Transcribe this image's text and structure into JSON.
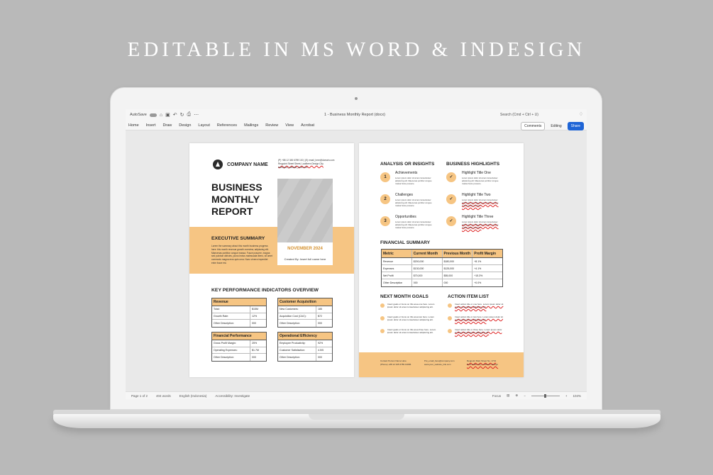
{
  "headline": "EDITABLE IN MS WORD & INDESIGN",
  "app": {
    "autosave_label": "AutoSave",
    "doc_title": "1 - Business Monthly Report (docx)",
    "search_placeholder": "Search (Cmd + Ctrl + U)",
    "tabs": [
      "Home",
      "Insert",
      "Draw",
      "Design",
      "Layout",
      "References",
      "Mailings",
      "Review",
      "View",
      "Acrobat"
    ],
    "comments_label": "Comments",
    "editing_label": "Editing",
    "share_label": "Share",
    "status": {
      "page": "Page 1 of 2",
      "words": "404 words",
      "language": "English (Indonesia)",
      "accessibility": "Accessibility: Investigate",
      "focus": "Focus",
      "zoom": "104%"
    }
  },
  "page1": {
    "company": "COMPANY NAME",
    "contact": [
      "(P) +88 12 345 6789 100  |  (E) email_here@domain.com",
      "Reqpoint Street Street, Laufbeen Design City",
      "www.your_website_here.com"
    ],
    "title_lines": [
      "BUSINESS",
      "MONTHLY",
      "REPORT"
    ],
    "exec_title": "EXECUTIVE SUMMARY",
    "exec_text": "Lorem the summary about this month business progress here: this month revenue growth overview, adipiscing elit. Maecenas porttitor congue massa. Fusce posuere, magna sed pulvinar ultricies, purus lectus malesuada libero, sit amet commodo magna eros quis urna. Nunc viverra imperdiet enim fusce est.",
    "month": "NOVEMBER 2024",
    "created": "Created By:  Insert full name here",
    "kpi_title": "KEY PERFORMANCE INDICATORS OVERVIEW",
    "kpi": [
      {
        "title": "Revenue",
        "rows": [
          [
            "Total:",
            "$15M"
          ],
          [
            "Growth Rate:",
            "12%"
          ],
          [
            "Other Description:",
            "000"
          ]
        ]
      },
      {
        "title": "Customer Acquisition",
        "rows": [
          [
            "New Customers:",
            "185"
          ],
          [
            "Acquisition Cost (CAC):",
            "$72"
          ],
          [
            "Other Description:",
            "000"
          ]
        ]
      },
      {
        "title": "Financial Performance",
        "rows": [
          [
            "Gross Profit Margin:",
            "25%"
          ],
          [
            "Operating Expenses:",
            "$1.7M"
          ],
          [
            "Other Description:",
            "000"
          ]
        ]
      },
      {
        "title": "Operational Efficiency",
        "rows": [
          [
            "Employee Productivity:",
            "92%"
          ],
          [
            "Customer Satisfaction:",
            "4.5/5"
          ],
          [
            "Other Description:",
            "000"
          ]
        ]
      }
    ]
  },
  "page2": {
    "analysis_title": "ANALYSIS OR INSIGHTS",
    "analysis": [
      {
        "num": "1",
        "title": "Achievements",
        "text": "Lorem ipsum dolor sit amet consectetuer adipiscing elit. Maecenas porttitor congue massa fusce posuere."
      },
      {
        "num": "2",
        "title": "Challenges",
        "text": "Lorem ipsum dolor sit amet consectetuer adipiscing elit. Maecenas porttitor congue massa fusce posuere."
      },
      {
        "num": "3",
        "title": "Opportunities",
        "text": "Lorem ipsum dolor sit amet consectetuer adipiscing elit. Maecenas porttitor congue massa fusce posuere."
      }
    ],
    "highlights_title": "BUSINESS HIGHLIGHTS",
    "highlights": [
      {
        "title": "Highlight Title One",
        "text": "Lorem ipsum dolor sit amet consectetuer adipiscing elit. Maecenas porttitor congue massa fusce posuere."
      },
      {
        "title": "Highlight Title Two",
        "text": "Lorem ipsum dolor sit amet consectetuer adipiscing elit. Maecenas porttitor congue massa fusce posuere."
      },
      {
        "title": "Highlight Title Three",
        "text": "Lorem ipsum dolor sit amet consectetuer adipiscing elit. Maecenas porttitor congue massa fusce posuere."
      }
    ],
    "financial_title": "FINANCIAL SUMMARY",
    "financial_headers": [
      "Metric",
      "Current Month",
      "Previous Month",
      "Profit Margin"
    ],
    "financial_rows": [
      [
        "Revenue",
        "$200,000",
        "$180,000",
        "+8.1%"
      ],
      [
        "Expenses",
        "$130,000",
        "$125,000",
        "+4.1%"
      ],
      [
        "Net Profit",
        "$70,000",
        "$55,000",
        "+15.3%"
      ],
      [
        "Other Description",
        "000",
        "000",
        "+0.0%"
      ]
    ],
    "goals_title": "NEXT MONTH GOALS",
    "goals": [
      "Insert goals or focus on this area one here. Lorem ipsum dolor sit amet consectetuer adipiscing elit.",
      "Insert goals or focus on this area two here. Lorem ipsum dolor sit amet consectetuer adipiscing elit.",
      "Insert goals or focus on this area three here. Lorem ipsum dolor sit amet consectetuer adipiscing elit."
    ],
    "actions_title": "ACTION ITEM LIST",
    "actions": [
      "Insert action title or one here. Lorem ipsum dolor sit amet consectetuer adipiscing elit.",
      "Insert action title or two here. Lorem ipsum dolor sit amet consectetuer adipiscing elit.",
      "Insert action title or three here. Lorem ipsum dolor sit amet consectetuer adipiscing elit."
    ],
    "footer": {
      "col1": [
        "Contact Person Name Here",
        "(Phone) +88 12 345 6789 10086"
      ],
      "col2": [
        "Put_email_here@company.com",
        "www.your_website_link.com"
      ],
      "col3": [
        "Reqpoint Main Street No. 1731",
        "New Hoffe City, Laufbeen Design"
      ]
    }
  },
  "colors": {
    "accent": "#f6c583",
    "share": "#1f65d6",
    "background": "#b9b9b9"
  }
}
